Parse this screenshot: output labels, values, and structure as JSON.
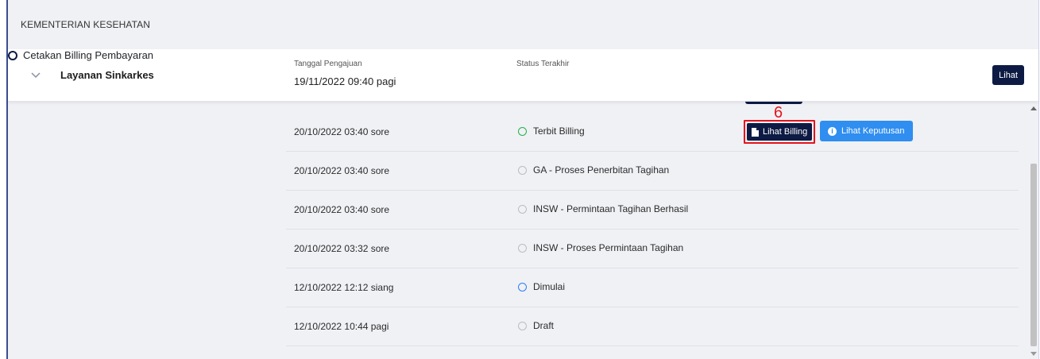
{
  "header": {
    "title": "KEMENTERIAN KESEHATAN"
  },
  "service": {
    "name": "Layanan Sinkarkes",
    "submit_label": "Tanggal Pengajuan",
    "submit_date": "19/11/2022 09:40 pagi",
    "status_label": "Status Terakhir",
    "status_value": "Cetakan Billing Pembayaran",
    "view_button": "Lihat"
  },
  "marker": "6",
  "history": [
    {
      "date": "20/10/2022 03:40 sore",
      "status": "Terbit Billing",
      "ring": "green",
      "btn_billing": "Lihat Billing",
      "btn_keputusan": "Lihat Keputusan"
    },
    {
      "date": "20/10/2022 03:40 sore",
      "status": "GA - Proses Penerbitan Tagihan",
      "ring": "gray"
    },
    {
      "date": "20/10/2022 03:40 sore",
      "status": "INSW - Permintaan Tagihan Berhasil",
      "ring": "gray"
    },
    {
      "date": "20/10/2022 03:32 sore",
      "status": "INSW - Proses Permintaan Tagihan",
      "ring": "gray"
    },
    {
      "date": "12/10/2022 12:12 siang",
      "status": "Dimulai",
      "ring": "blue"
    },
    {
      "date": "12/10/2022 10:44 pagi",
      "status": "Draft",
      "ring": "gray"
    }
  ],
  "colors": {
    "primary": "#0d1b44",
    "info": "#2f8ef0",
    "highlight": "#e4141b",
    "success": "#22b14c"
  },
  "icons": {
    "expand": "chevron-down-icon",
    "billing": "file-icon",
    "info": "info-circle-icon"
  }
}
